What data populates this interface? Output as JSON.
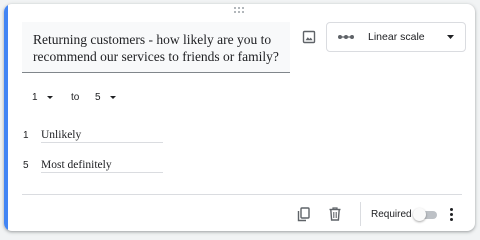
{
  "question": {
    "text": "Returning customers - how likely are you to recommend our services to friends or family?"
  },
  "question_type": {
    "selected": "Linear scale",
    "icon": "linear-scale-icon"
  },
  "scale": {
    "min": "1",
    "to_label": "to",
    "max": "5"
  },
  "labels": [
    {
      "number": "1",
      "text": "Unlikely"
    },
    {
      "number": "5",
      "text": "Most definitely"
    }
  ],
  "footer": {
    "required_label": "Required",
    "required_on": false
  },
  "colors": {
    "accent": "#4285f4",
    "toggle_track": "#bdc1c6"
  }
}
